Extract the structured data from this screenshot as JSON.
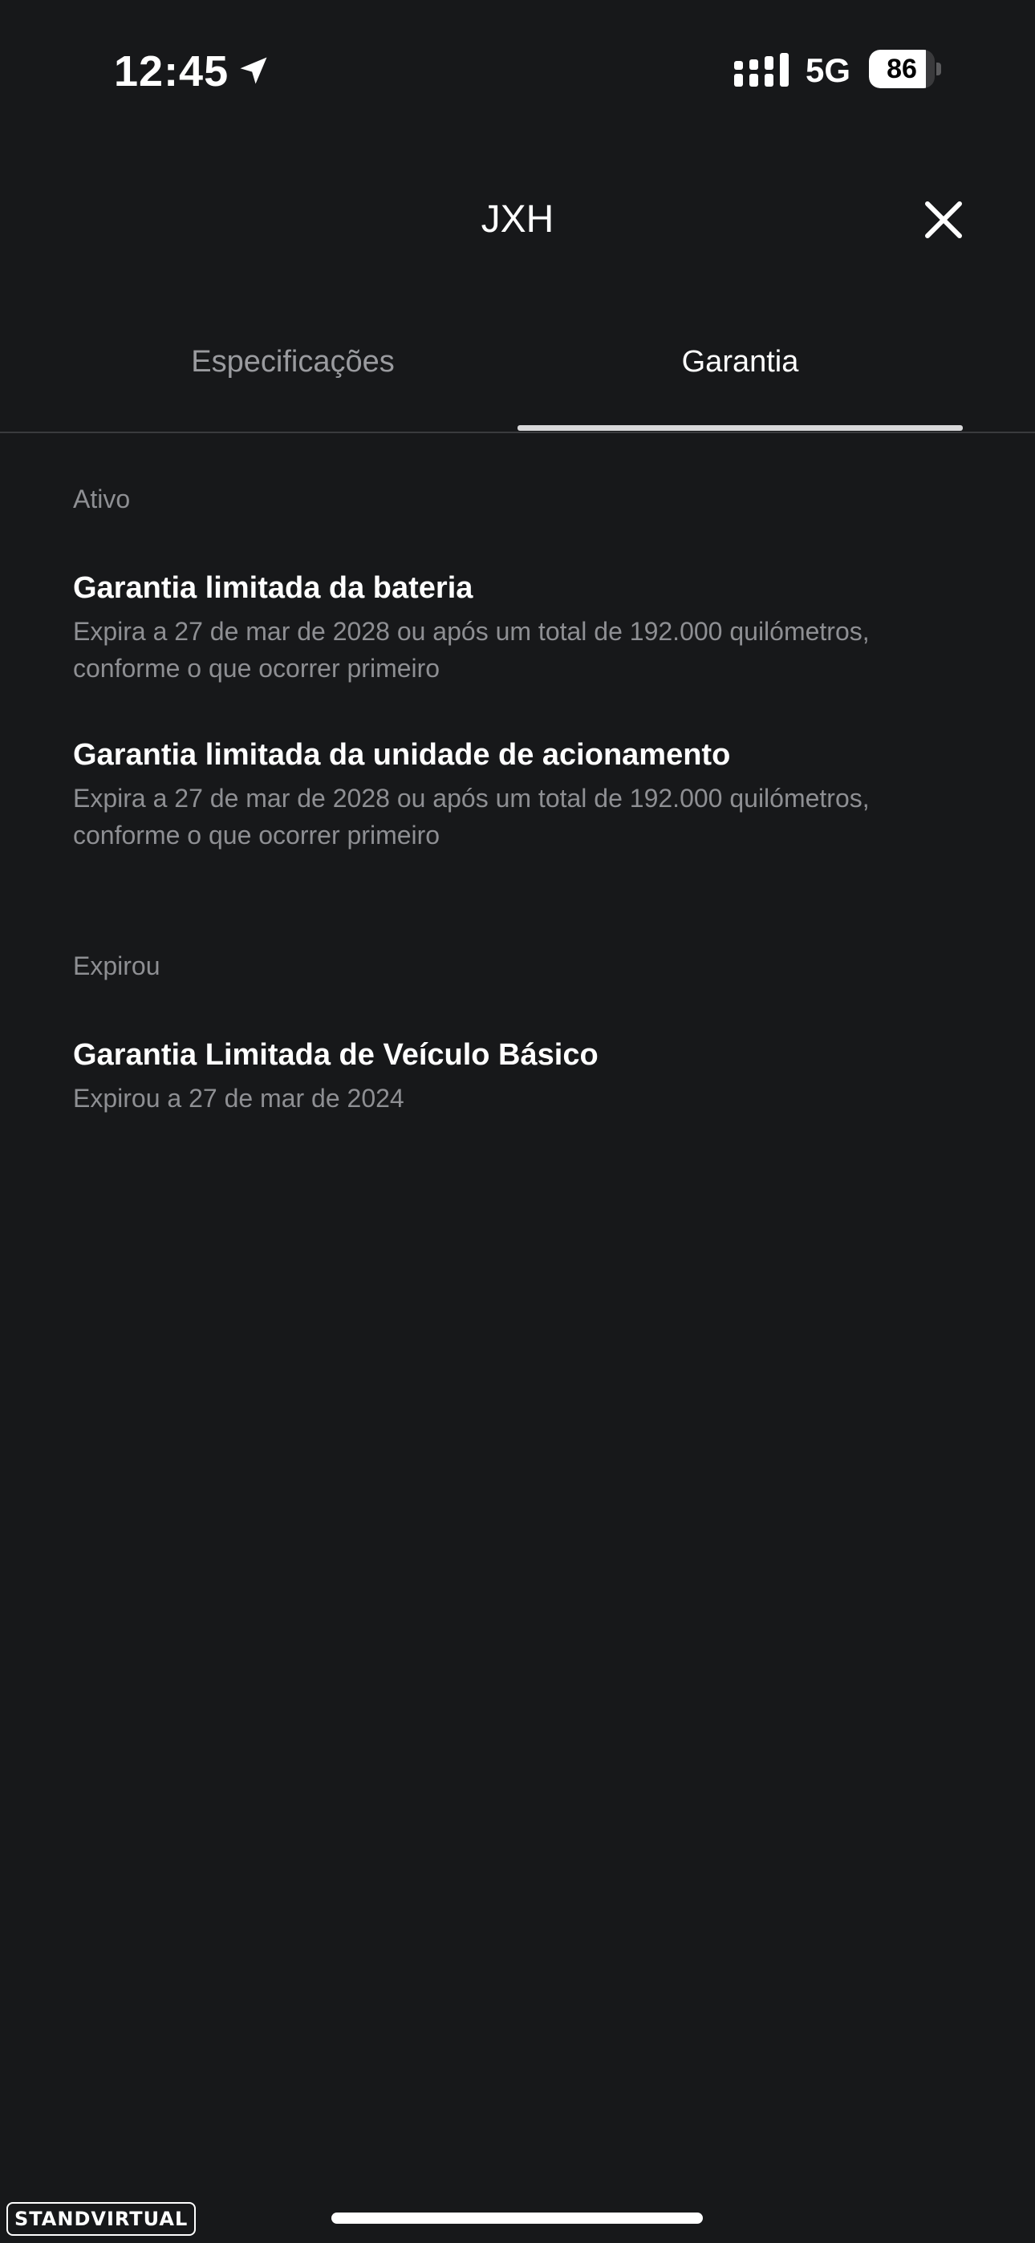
{
  "status_bar": {
    "time": "12:45",
    "network": "5G",
    "battery_level": "86",
    "battery_fraction": 0.86
  },
  "header": {
    "title": "JXH"
  },
  "tabs": [
    {
      "label": "Especificações",
      "selected": false
    },
    {
      "label": "Garantia",
      "selected": true
    }
  ],
  "sections": {
    "active": {
      "label": "Ativo",
      "items": [
        {
          "title": "Garantia limitada da bateria",
          "description": "Expira a 27 de mar de 2028 ou após um total de 192.000 quilómetros, conforme o que ocorrer primeiro"
        },
        {
          "title": "Garantia limitada da unidade de acionamento",
          "description": "Expira a 27 de mar de 2028 ou após um total de 192.000 quilómetros, conforme o que ocorrer primeiro"
        }
      ]
    },
    "expired": {
      "label": "Expirou",
      "items": [
        {
          "title": "Garantia Limitada de Veículo Básico",
          "description": "Expirou a 27 de mar de 2024"
        }
      ]
    }
  },
  "watermark": "STANDVIRTUAL",
  "icons": {
    "location": "location-arrow-icon",
    "signal": "signal-bars-icon",
    "close": "close-icon"
  },
  "colors": {
    "background": "#17181a",
    "primary_text": "#ffffff",
    "secondary_text": "#8e8f93",
    "tab_inactive": "#9a9b9f",
    "tab_indicator": "#d8d8da"
  }
}
